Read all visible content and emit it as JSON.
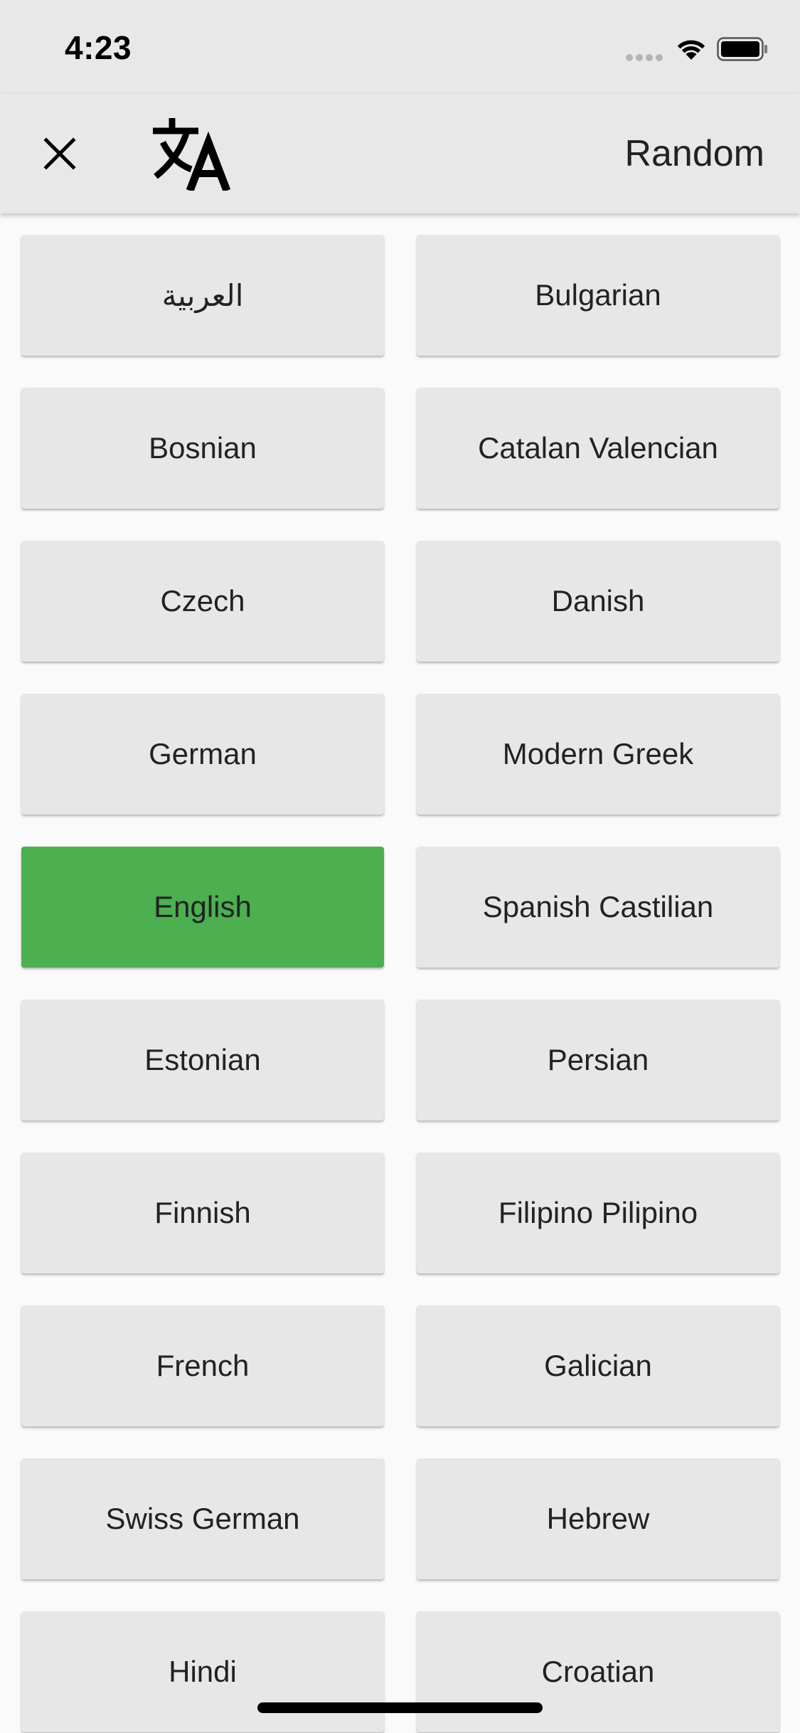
{
  "status_bar": {
    "time": "4:23"
  },
  "app_bar": {
    "close_icon": "close-icon",
    "translate_icon": "translate-icon",
    "random_label": "Random"
  },
  "colors": {
    "bar_background": "#e8e8e8",
    "button_background": "#e7e7e7",
    "selected": "#4caf50"
  },
  "selected_language": "English",
  "languages": [
    "العربية",
    "Bulgarian",
    "Bosnian",
    "Catalan Valencian",
    "Czech",
    "Danish",
    "German",
    "Modern Greek",
    "English",
    "Spanish Castilian",
    "Estonian",
    "Persian",
    "Finnish",
    "Filipino Pilipino",
    "French",
    "Galician",
    "Swiss German",
    "Hebrew",
    "Hindi",
    "Croatian"
  ]
}
